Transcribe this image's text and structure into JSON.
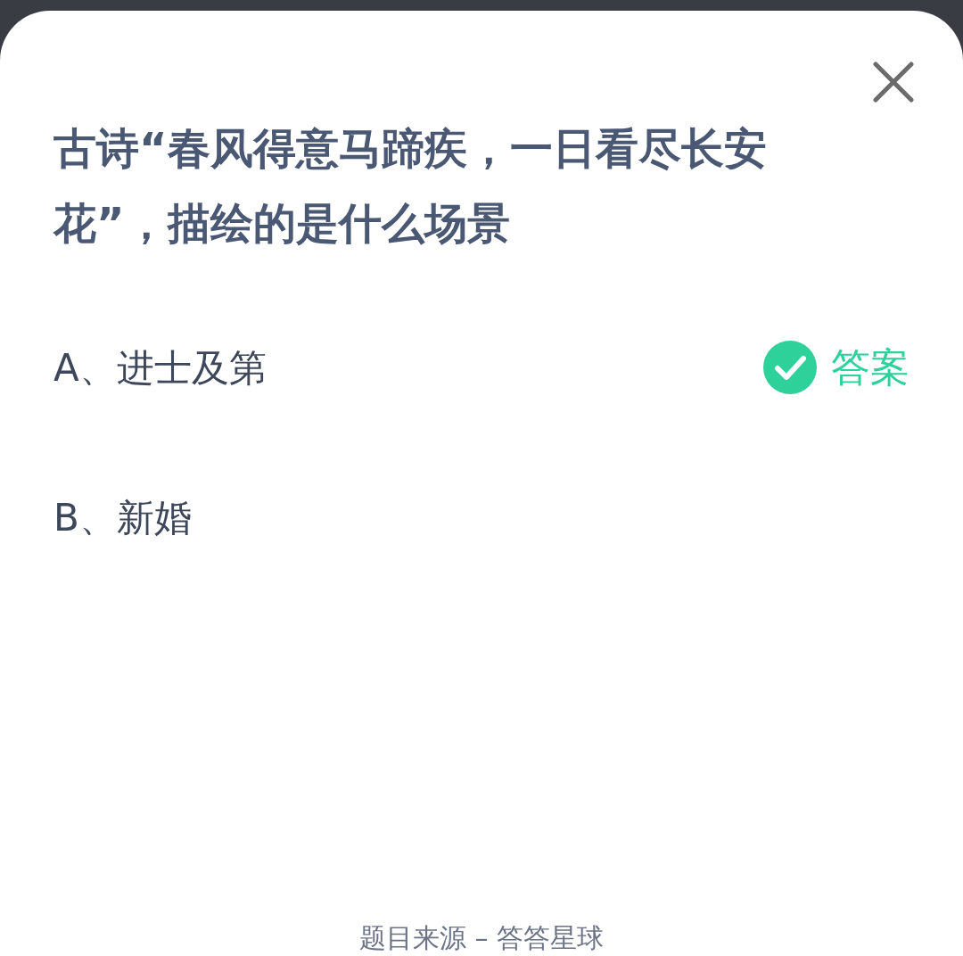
{
  "question": "古诗“春风得意马蹄疾，一日看尽长安花”，描绘的是什么场景",
  "options": [
    {
      "label": "A、进士及第",
      "is_answer": true
    },
    {
      "label": "B、新婚",
      "is_answer": false
    }
  ],
  "answer_badge": "答案",
  "footer": "题目来源 – 答答星球"
}
